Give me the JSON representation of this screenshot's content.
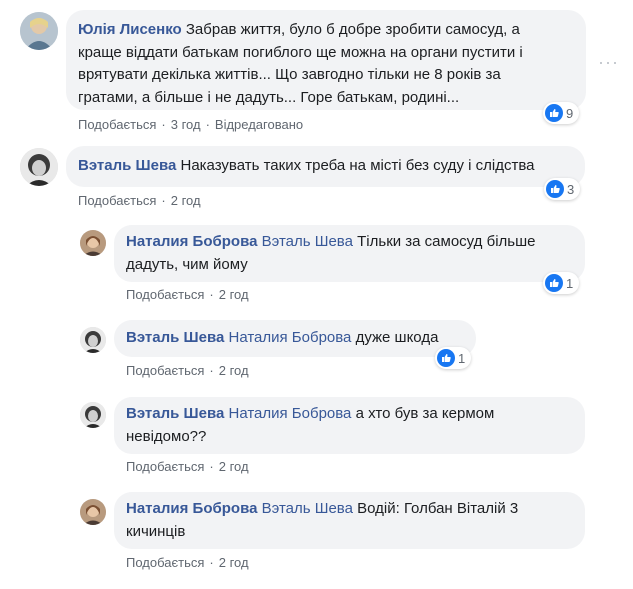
{
  "comments": [
    {
      "author": "Юлія Лисенко",
      "mention": "",
      "text_lines": [
        "Забрав життя, було б добре зробити самосуд, а",
        "краще віддати батькам погиблого ще можна на органи пустити і",
        "врятувати декілька життів... Що завгодно тільки не 8 років за",
        "гратами, а більше і не дадуть... Горе батькам, родині..."
      ],
      "like_label": "Подобається",
      "time": "3 год",
      "edited_label": "Відредаговано",
      "reactions": "9"
    },
    {
      "author": "Вэталь Шева",
      "mention": "",
      "text": "Наказувать таких треба на місті без суду і слідства",
      "like_label": "Подобається",
      "time": "2 год",
      "reactions": "3"
    }
  ],
  "replies": [
    {
      "author": "Наталия Боброва",
      "mention": "Вэталь Шева",
      "text_first": "Тільки за самосуд більше",
      "text_second": "дадуть, чим йому",
      "like_label": "Подобається",
      "time": "2 год",
      "reactions": "1"
    },
    {
      "author": "Вэталь Шева",
      "mention": "Наталия Боброва",
      "text": "дуже шкода",
      "like_label": "Подобається",
      "time": "2 год",
      "reactions": "1"
    },
    {
      "author": "Вэталь Шева",
      "mention": "Наталия Боброва",
      "text_first": "а хто був за кермом",
      "text_second": "невідомо??",
      "like_label": "Подобається",
      "time": "2 год"
    },
    {
      "author": "Наталия Боброва",
      "mention": "Вэталь Шева",
      "text_first": "Водій: Голбан Віталій 3",
      "text_second": "кичинців",
      "like_label": "Подобається",
      "time": "2 год"
    }
  ],
  "colors": {
    "bubble": "#f2f3f5",
    "name": "#385898",
    "meta": "#606770",
    "like_badge": "#1877f2"
  },
  "icons": {
    "like": "thumbs-up-icon",
    "options": "more-options-icon"
  }
}
